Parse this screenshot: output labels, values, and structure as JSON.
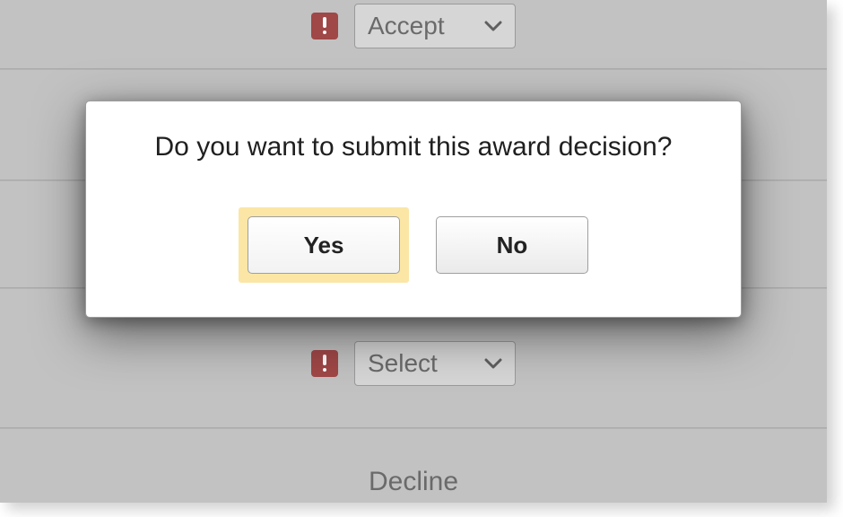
{
  "background": {
    "rows": [
      {
        "type": "select",
        "value": "Accept"
      },
      {
        "type": "select",
        "value": "Select"
      },
      {
        "type": "label",
        "value": "Decline"
      }
    ]
  },
  "modal": {
    "message": "Do you want to submit this award decision?",
    "yes_label": "Yes",
    "no_label": "No"
  },
  "colors": {
    "warn_badge": "#a04747",
    "highlight": "#fbe6a6"
  }
}
